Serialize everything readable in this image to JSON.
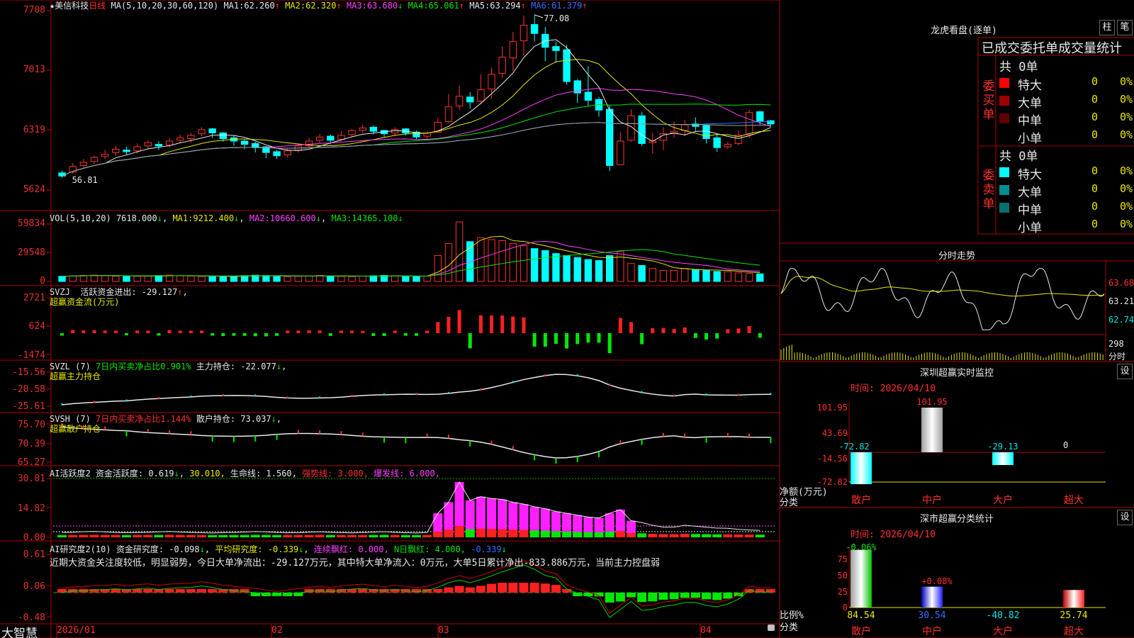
{
  "stock": {
    "name": "美信科技",
    "period": "日线",
    "ma_header": "MA(5,10,20,30,60,120)",
    "ma1_label": "MA1:",
    "ma1": "62.260",
    "ma1_arrow": "↑",
    "ma2_label": "MA2:",
    "ma2": "62.320",
    "ma2_arrow": "↑",
    "ma3_label": "MA3:",
    "ma3": "63.680",
    "ma3_arrow": "↓",
    "ma4_label": "MA4:",
    "ma4": "65.061",
    "ma4_arrow": "↑",
    "ma5_label": "MA5:",
    "ma5": "63.294",
    "ma5_arrow": "↑",
    "ma6_label": "MA6:",
    "ma6": "61.379",
    "ma6_arrow": "↑",
    "high_mark": "77.08",
    "low_mark": "56.81",
    "price_axis": [
      "7708",
      "7013",
      "6319",
      "5624"
    ]
  },
  "vol_panel": {
    "header": "VOL(5,10,20)",
    "vol": "7618.000",
    "vol_arrow": "↓",
    "ma1_label": "MA1:",
    "ma1": "9212.400",
    "ma1_arrow": "↓",
    "ma2_label": "MA2:",
    "ma2": "10660.600",
    "ma2_arrow": "↓",
    "ma3_label": "MA3:",
    "ma3": "14365.100",
    "ma3_arrow": "↓",
    "axis": [
      "59834",
      "29548",
      "0"
    ]
  },
  "svzj_panel": {
    "header": "SVZJ",
    "label": "活跃资金进出:",
    "value": "-29.127",
    "arrow": "↑",
    "suffix": ",",
    "subtitle": "超赢资金流(万元)",
    "axis": [
      "2721",
      "624",
      "-1474"
    ]
  },
  "svzl_panel": {
    "header": "SVZL (7)",
    "ratio": "7日内买卖净占比0.901%",
    "label": "主力持仓:",
    "value": "-22.077",
    "arrow": "↓",
    "suffix": ",",
    "subtitle": "超赢主力持仓",
    "axis": [
      "-15.56",
      "-20.58",
      "-25.61"
    ]
  },
  "svsh_panel": {
    "header": "SVSH (7)",
    "ratio": "7日内买卖净占比1.144%",
    "label": "散户持仓:",
    "value": "73.037",
    "arrow": "↓",
    "suffix": ",",
    "subtitle": "超赢散户持仓",
    "axis": [
      "75.70",
      "70.39",
      "65.27"
    ]
  },
  "ai1_panel": {
    "header": "AI活跃度2",
    "label": "资金活跃度:",
    "value": "0.619",
    "arrow": "↓",
    "v2": "30.010",
    "v2_suffix": ",",
    "life_label": "生命线:",
    "life": "1.560",
    "life_suffix": ",",
    "strong_label": "强势线:",
    "strong": "3.000",
    "strong_suffix": ",",
    "burst_label": "爆发线:",
    "burst": "6.000",
    "burst_suffix": ",",
    "axis": [
      "30.01",
      "14.82",
      "0.00"
    ]
  },
  "ai2_panel": {
    "header": "AI研究度2(10)",
    "label": "资金研究度:",
    "value": "-0.098",
    "arrow": "↓",
    "suffix": ",",
    "avg_label": "平均研究度:",
    "avg": "-0.339",
    "avg_arrow": "↓",
    "avg_suffix": ",",
    "red_label": "连续飘红:",
    "red": "0.000",
    "red_suffix": ",",
    "nred_label": "N日飘红:",
    "nred": "4.000",
    "nred_suffix": ",",
    "last": "-0.339",
    "last_arrow": "↓",
    "comment": "近期大资金关注度较低，明显弱势，今日大单净流出：-29.127万元，其中特大单净流入：0万元，大单5日累计净出-833.886万元，当前主力控盘弱",
    "axis": [
      "0.61",
      "0.06",
      "-0.48"
    ]
  },
  "date_axis": [
    "2026/01",
    "02",
    "03",
    "04"
  ],
  "brand": "大智慧",
  "right": {
    "dragon_title": "龙虎看盘(逐单)",
    "btn_zhu": "柱",
    "btn_bi": "笔",
    "tab_header": "已成交委托单成交量统计",
    "buy_total": "共 0单",
    "buy_label": "委买单",
    "sell_total": "共 0单",
    "sell_label": "委卖单",
    "levels": [
      {
        "name": "特大",
        "count": "0",
        "pct": "0%"
      },
      {
        "name": "大单",
        "count": "0",
        "pct": "0%"
      },
      {
        "name": "中单",
        "count": "0",
        "pct": "0%"
      },
      {
        "name": "小单",
        "count": "0",
        "pct": "0%"
      }
    ],
    "buy_colors": [
      "#ff0000",
      "#a00000",
      "#600000",
      "#000000"
    ],
    "sell_colors": [
      "#00ffff",
      "#009090",
      "#007070",
      "#000000"
    ],
    "fenshi_title": "分时走势",
    "fenshi_axis": [
      "63.68",
      "63.21",
      "62.74"
    ],
    "fenshi_vol_label": "298",
    "fenshi_vol_unit": "分时",
    "monitor_title": "深圳超赢实时监控",
    "monitor_btn": "设",
    "monitor_time": "时间: 2026/04/10",
    "monitor_axis": [
      "101.95",
      "43.69",
      "-14.56",
      "-72.82"
    ],
    "monitor_unit": "净额(万元)",
    "monitor_cat_label": "分类",
    "monitor_cats": [
      "散户",
      "中户",
      "大户",
      "超大"
    ],
    "monitor_values_text": [
      "-72.82",
      "101.95",
      "-29.13",
      "0"
    ],
    "class_title": "深市超赢分类统计",
    "class_btn": "设",
    "class_time": "时间: 2026/04/10",
    "class_axis": [
      "75",
      "50",
      "25",
      "0"
    ],
    "class_unit": "比例%",
    "class_cat_label": "分类",
    "class_top_labels": [
      "-0.06%",
      "+0.08%"
    ],
    "class_bottom_values": [
      "84.54",
      "30.54",
      "-40.82",
      "25.74"
    ],
    "class_cats": [
      "散户",
      "中户",
      "大户",
      "超大"
    ]
  },
  "chart_data": {
    "type": "candlestick",
    "title": "美信科技 日线",
    "x_axis_labels": [
      "2026/01",
      "02",
      "03",
      "04"
    ],
    "candles": [
      [
        57.7,
        57.3,
        58.0,
        57.1
      ],
      [
        57.8,
        58.5,
        58.9,
        57.6
      ],
      [
        58.6,
        59.0,
        59.4,
        58.3
      ],
      [
        59.1,
        59.6,
        59.8,
        58.8
      ],
      [
        59.7,
        60.0,
        60.5,
        59.4
      ],
      [
        60.2,
        60.6,
        61.0,
        59.8
      ],
      [
        60.5,
        60.3,
        60.9,
        59.9
      ],
      [
        60.4,
        60.9,
        61.3,
        60.1
      ],
      [
        61.0,
        61.4,
        61.7,
        60.7
      ],
      [
        61.2,
        61.0,
        61.6,
        60.5
      ],
      [
        61.1,
        61.6,
        62.0,
        60.8
      ],
      [
        61.7,
        62.0,
        62.4,
        61.3
      ],
      [
        61.9,
        62.3,
        62.6,
        61.4
      ],
      [
        62.5,
        63.0,
        63.3,
        62.2
      ],
      [
        63.1,
        62.6,
        63.2,
        62.0
      ],
      [
        62.6,
        61.9,
        62.7,
        61.5
      ],
      [
        62.0,
        61.6,
        62.3,
        61.0
      ],
      [
        61.6,
        61.2,
        61.8,
        60.6
      ],
      [
        61.3,
        60.8,
        61.5,
        60.2
      ],
      [
        60.9,
        60.2,
        61.0,
        59.5
      ],
      [
        60.3,
        59.8,
        60.5,
        59.4
      ],
      [
        59.9,
        60.4,
        60.7,
        59.6
      ],
      [
        60.5,
        61.0,
        61.2,
        60.2
      ],
      [
        61.0,
        61.6,
        62.0,
        60.8
      ],
      [
        61.7,
        62.1,
        62.5,
        61.4
      ],
      [
        62.2,
        61.7,
        62.4,
        61.2
      ],
      [
        61.8,
        62.3,
        62.8,
        61.6
      ],
      [
        62.4,
        62.9,
        63.1,
        62.1
      ],
      [
        62.9,
        63.2,
        63.6,
        62.6
      ],
      [
        63.3,
        62.8,
        63.5,
        62.4
      ],
      [
        62.9,
        62.5,
        63.0,
        62.1
      ],
      [
        62.6,
        63.0,
        63.3,
        62.2
      ],
      [
        63.1,
        62.6,
        63.2,
        62.3
      ],
      [
        62.7,
        62.1,
        62.9,
        61.8
      ],
      [
        62.2,
        62.6,
        62.8,
        61.9
      ],
      [
        62.7,
        63.9,
        64.5,
        62.6
      ],
      [
        64.0,
        65.8,
        67.4,
        63.8
      ],
      [
        65.9,
        67.1,
        68.4,
        65.4
      ],
      [
        67.0,
        66.4,
        67.6,
        65.6
      ],
      [
        66.5,
        67.9,
        69.8,
        66.2
      ],
      [
        68.0,
        69.8,
        70.6,
        66.8
      ],
      [
        69.9,
        71.9,
        73.2,
        69.3
      ],
      [
        71.8,
        73.8,
        75.0,
        70.2
      ],
      [
        73.9,
        75.8,
        77.0,
        72.1
      ],
      [
        75.9,
        74.8,
        77.08,
        73.8
      ],
      [
        74.7,
        73.1,
        75.6,
        71.4
      ],
      [
        73.2,
        72.7,
        73.8,
        71.2
      ],
      [
        72.8,
        68.9,
        73.4,
        68.5
      ],
      [
        69.0,
        67.5,
        69.2,
        66.3
      ],
      [
        67.6,
        66.6,
        70.8,
        65.9
      ],
      [
        66.7,
        65.4,
        67.0,
        64.6
      ],
      [
        65.5,
        58.6,
        66.0,
        57.9
      ],
      [
        58.7,
        61.6,
        62.7,
        59.4
      ],
      [
        61.7,
        64.7,
        65.5,
        61.5
      ],
      [
        64.7,
        61.3,
        65.2,
        61.0
      ],
      [
        61.4,
        61.6,
        62.6,
        60.1
      ],
      [
        61.7,
        62.5,
        63.3,
        60.5
      ],
      [
        62.6,
        62.8,
        64.0,
        62.0
      ],
      [
        62.9,
        63.6,
        64.2,
        62.2
      ],
      [
        63.7,
        63.4,
        64.5,
        62.8
      ],
      [
        63.5,
        61.9,
        63.6,
        61.3
      ],
      [
        62.0,
        60.8,
        62.5,
        60.3
      ],
      [
        60.9,
        61.2,
        61.5,
        60.6
      ],
      [
        61.3,
        62.3,
        62.9,
        61.1
      ],
      [
        62.4,
        65.1,
        65.4,
        62.0
      ],
      [
        65.2,
        64.0,
        65.3,
        63.6
      ],
      [
        64.1,
        63.7,
        64.2,
        63.3
      ]
    ],
    "volume": [
      5200,
      5600,
      6100,
      6400,
      5900,
      5300,
      5000,
      5200,
      5500,
      5900,
      6400,
      5800,
      5300,
      5000,
      4700,
      5100,
      5400,
      5800,
      6300,
      5900,
      5400,
      4900,
      5100,
      5600,
      6000,
      5500,
      5100,
      4800,
      5300,
      5700,
      6100,
      5500,
      5000,
      4700,
      5300,
      26000,
      38000,
      59834,
      40000,
      44000,
      42000,
      41000,
      38000,
      36000,
      33000,
      31000,
      28000,
      26000,
      24000,
      22000,
      21000,
      26000,
      30000,
      18000,
      16000,
      13000,
      11000,
      11000,
      13000,
      12000,
      11000,
      10000,
      9800,
      8600,
      8000,
      7618
    ],
    "ma_lines": {
      "MA1": {
        "color": "#e8e8e8",
        "last": 62.26
      },
      "MA2": {
        "color": "#e8e800",
        "last": 62.32
      },
      "MA3": {
        "color": "#ff40ff",
        "last": 63.68
      },
      "MA4": {
        "color": "#00e800",
        "last": 65.061
      },
      "MA5": {
        "color": "#3070ff",
        "last": 63.294
      },
      "MA6": {
        "color": "#a0a0a0",
        "last": 61.379
      }
    },
    "ylim": [
      55.6,
      77.6
    ]
  }
}
